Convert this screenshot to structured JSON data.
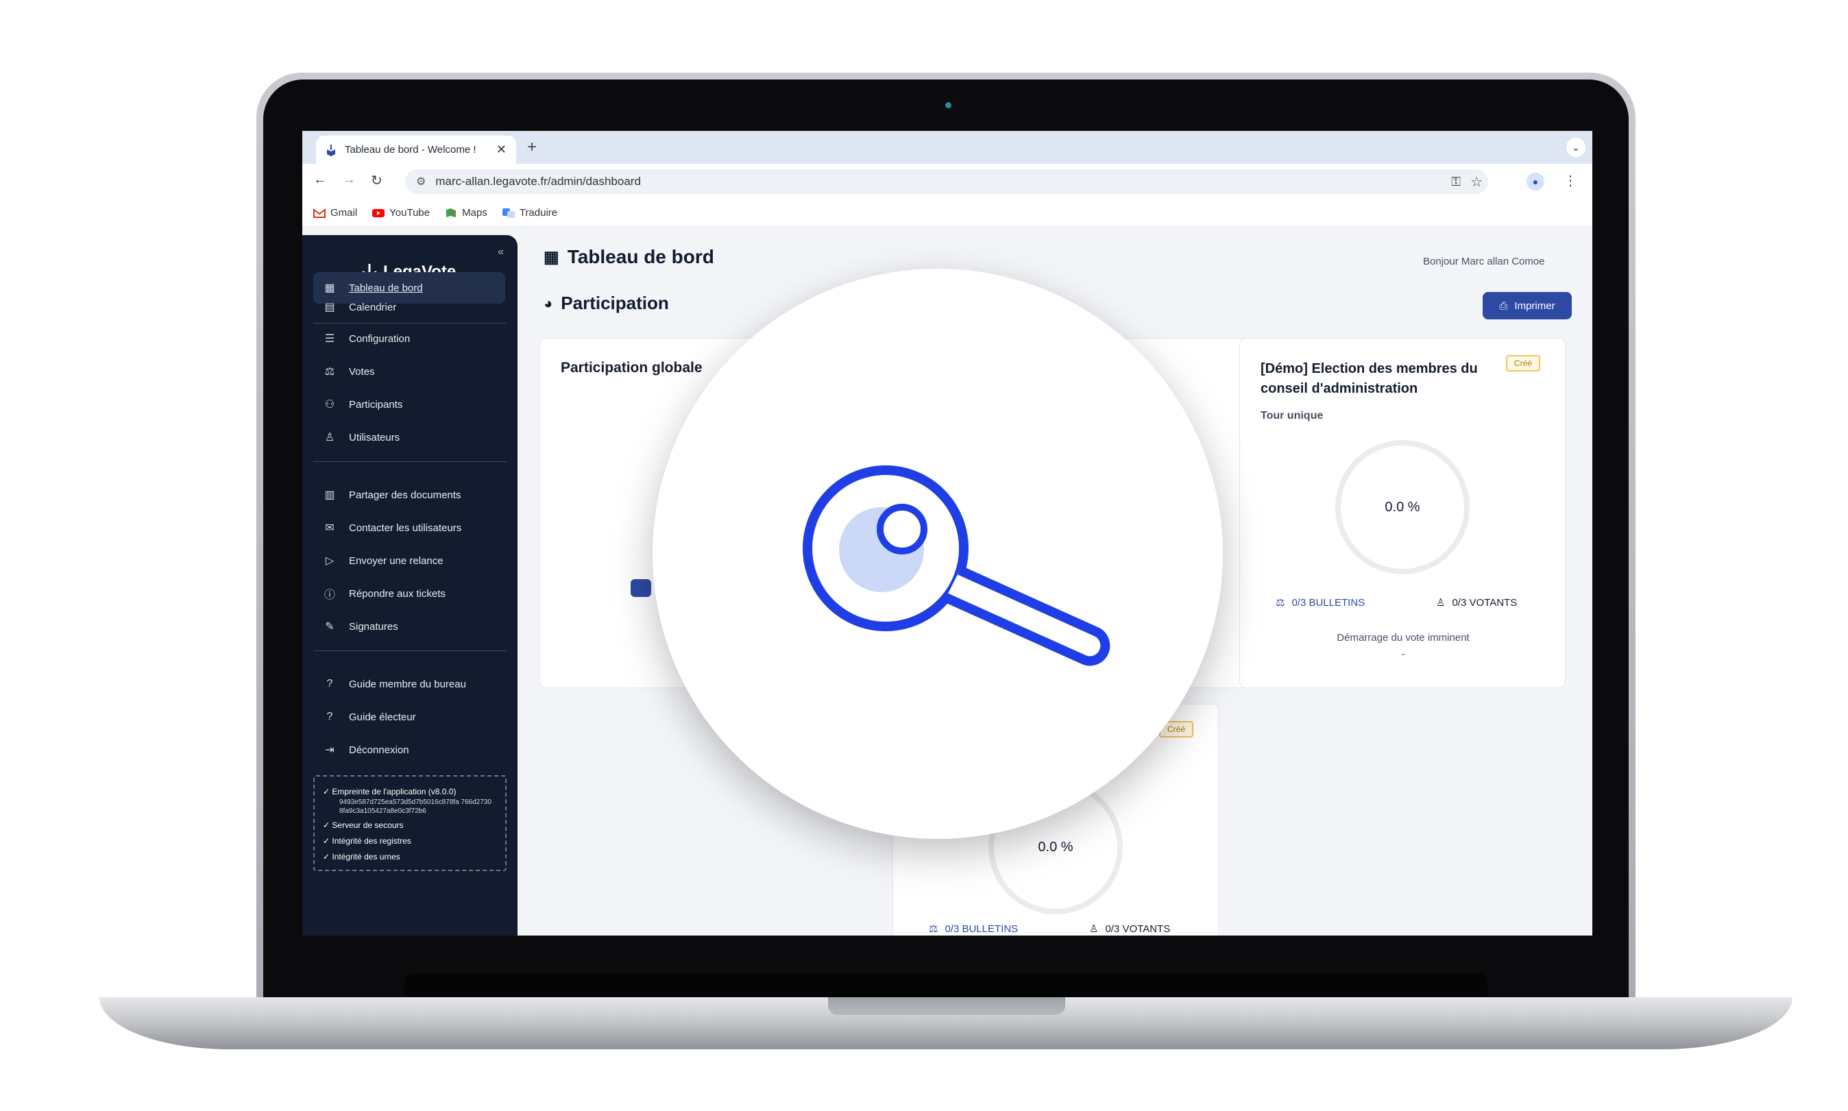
{
  "browser": {
    "tab_title": "Tableau de bord - Welcome !",
    "url": "marc-allan.legavote.fr/admin/dashboard",
    "bookmarks": [
      "Gmail",
      "YouTube",
      "Maps",
      "Traduire"
    ]
  },
  "sidebar": {
    "logo": "LegaVote",
    "items_top": [
      {
        "label": "Tableau de bord",
        "icon": "grid-icon"
      },
      {
        "label": "Calendrier",
        "icon": "calendar-icon"
      }
    ],
    "items_config": [
      {
        "label": "Configuration",
        "icon": "sliders-icon"
      },
      {
        "label": "Votes",
        "icon": "ballot-icon"
      },
      {
        "label": "Participants",
        "icon": "users-icon"
      },
      {
        "label": "Utilisateurs",
        "icon": "user-icon"
      }
    ],
    "items_comm": [
      {
        "label": "Partager des documents",
        "icon": "document-icon"
      },
      {
        "label": "Contacter les utilisateurs",
        "icon": "mail-icon"
      },
      {
        "label": "Envoyer une relance",
        "icon": "send-icon"
      },
      {
        "label": "Répondre aux tickets",
        "icon": "alert-icon"
      },
      {
        "label": "Signatures",
        "icon": "pen-icon"
      }
    ],
    "items_help": [
      {
        "label": "Guide membre du bureau",
        "icon": "help-icon"
      },
      {
        "label": "Guide électeur",
        "icon": "help-icon"
      },
      {
        "label": "Déconnexion",
        "icon": "logout-icon"
      }
    ],
    "integrity": {
      "fingerprint_label": "✓ Empreinte de l'application (v8.0.0)",
      "fingerprint_hash": "9493e587d725ea573d5d7b5016c878fa 766d2730 8fa9c3a105427a8e0c3f72b6",
      "backup_server": "✓ Serveur de secours",
      "registers": "✓ Intégrité des registres",
      "urns": "✓ Intégrité des urnes"
    }
  },
  "main": {
    "page_title": "Tableau de bord",
    "greeting": "Bonjour Marc allan Comoe",
    "section_title": "Participation",
    "print_label": "Imprimer",
    "card_global": {
      "title": "Participation globale"
    },
    "card_election": {
      "title_line1": "[Démo] Election des membres du",
      "title_line2": "conseil d'administration",
      "badge": "Créé",
      "subtitle": "Tour unique",
      "percent": "0.0 %",
      "bulletins": "0/3 BULLETINS",
      "votants": "0/3 VOTANTS",
      "status": "Démarrage du vote imminent",
      "dash": "-"
    },
    "card_middle_top": {
      "badge": "Créé"
    },
    "card_middle_bottom": {
      "percent_partial": "0.0 %",
      "bulletins": "0/3 BULLETINS",
      "votants": "0/3 VOTANTS"
    }
  },
  "colors": {
    "sidebar_bg": "#131c2e",
    "accent_blue": "#2d4aa3",
    "magnifier_blue": "#1f3ee6",
    "badge_yellow": "#efc45a"
  }
}
